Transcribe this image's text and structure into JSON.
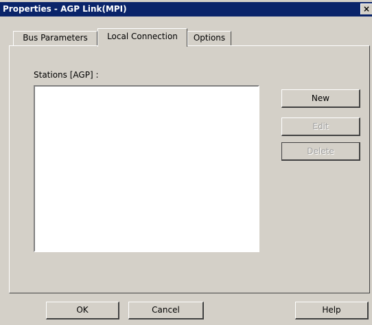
{
  "window": {
    "title": "Properties - AGP Link(MPI)",
    "close_glyph": "×"
  },
  "tabs": [
    {
      "label": "Bus Parameters"
    },
    {
      "label": "Local Connection",
      "selected": true
    },
    {
      "label": "Options"
    }
  ],
  "stations": {
    "label": "Stations [AGP] :",
    "items": []
  },
  "side_buttons": {
    "new": {
      "label": "New",
      "enabled": true
    },
    "edit": {
      "label": "Edit",
      "enabled": false
    },
    "delete": {
      "label": "Delete",
      "enabled": false
    }
  },
  "footer": {
    "ok": "OK",
    "cancel": "Cancel",
    "help": "Help"
  }
}
